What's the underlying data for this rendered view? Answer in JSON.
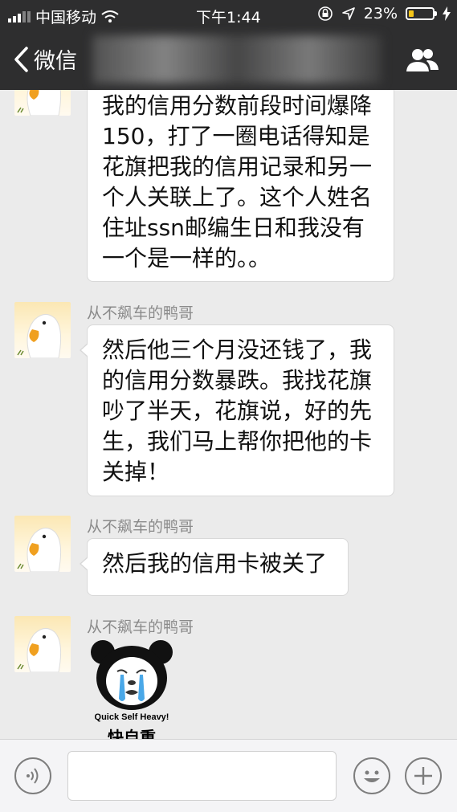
{
  "status_bar": {
    "carrier": "中国移动",
    "time": "下午1:44",
    "battery_percent": "23%",
    "battery_level": 0.23
  },
  "nav": {
    "back_label": "微信"
  },
  "messages": [
    {
      "sender": "",
      "text": "我的信用分数前段时间爆降150，打了一圈电话得知是花旗把我的信用记录和另一个人关联上了。这个人姓名住址ssn邮编生日和我没有一个是一样的。。"
    },
    {
      "sender": "从不飙车的鸭哥",
      "text": "然后他三个月没还钱了，我的信用分数暴跌。我找花旗吵了半天，花旗说，好的先生，我们马上帮你把他的卡关掉！"
    },
    {
      "sender": "从不飙车的鸭哥",
      "text": "然后我的信用卡被关了"
    },
    {
      "sender": "从不飙车的鸭哥",
      "sticker": {
        "caption_en": "Quick Self Heavy!",
        "caption_zh": "快自重"
      }
    }
  ],
  "icons": {
    "back": "chevron-left-icon",
    "group": "group-icon",
    "voice": "voice-icon",
    "emoji": "emoji-icon",
    "plus": "plus-icon"
  }
}
